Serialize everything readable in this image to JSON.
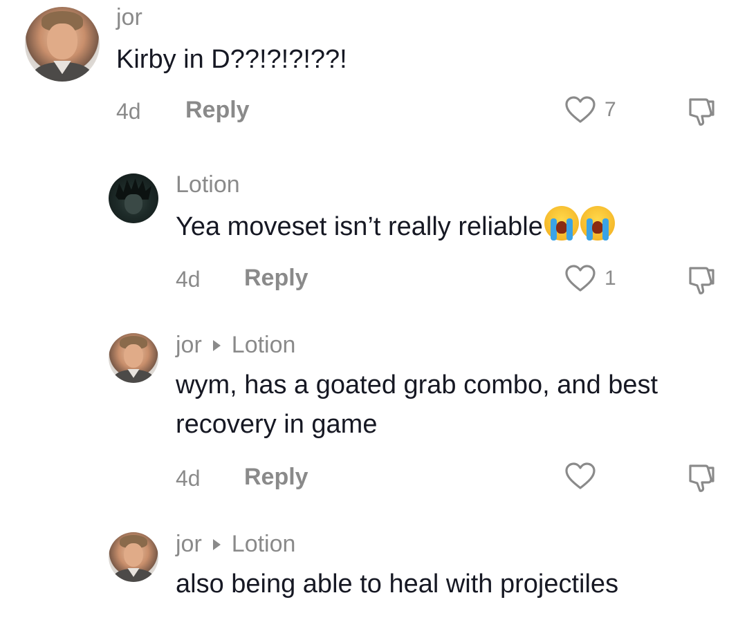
{
  "comments": [
    {
      "username": "jor",
      "text": "Kirby in D??!?!?!??!",
      "age": "4d",
      "reply_label": "Reply",
      "likes": "7",
      "avatar": "man-face-avatar"
    },
    {
      "username": "Lotion",
      "text": "Yea moveset isn’t really reliable",
      "emoji": [
        "loudly-crying-face-emoji",
        "loudly-crying-face-emoji"
      ],
      "age": "4d",
      "reply_label": "Reply",
      "likes": "1",
      "avatar": "anime-character-avatar"
    },
    {
      "username": "jor",
      "reply_to": "Lotion",
      "text": "wym, has a goated grab combo, and best recovery in game",
      "age": "4d",
      "reply_label": "Reply",
      "likes": "",
      "avatar": "man-face-avatar"
    },
    {
      "username": "jor",
      "reply_to": "Lotion",
      "text": "also being able to heal with projectiles",
      "avatar": "man-face-avatar"
    }
  ],
  "colors": {
    "text": "#161823",
    "muted": "#8a8a8a",
    "emoji_tears": "#3aa3e6"
  }
}
